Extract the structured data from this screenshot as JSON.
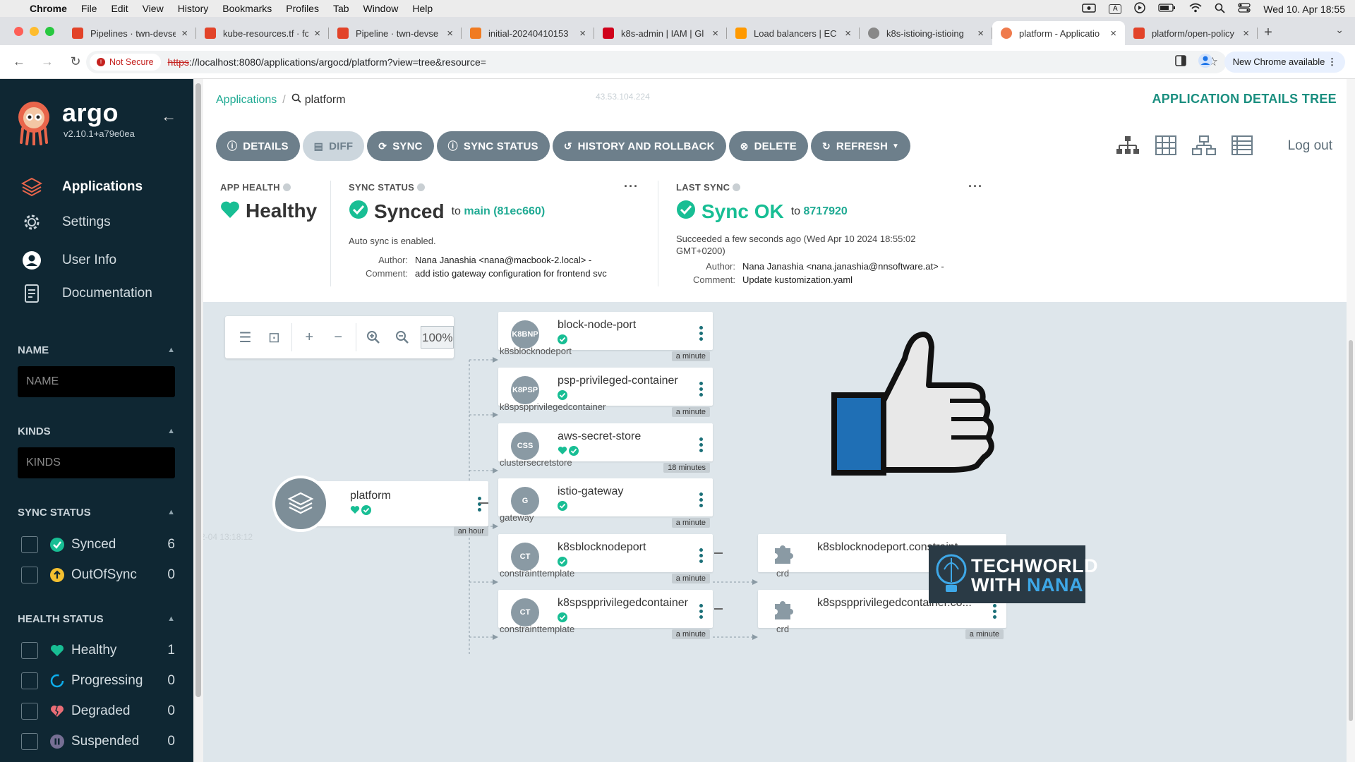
{
  "menubar": {
    "app": "Chrome",
    "items": [
      "File",
      "Edit",
      "View",
      "History",
      "Bookmarks",
      "Profiles",
      "Tab",
      "Window",
      "Help"
    ],
    "clock": "Wed 10. Apr  18:55",
    "input_indicator": "A"
  },
  "tabs": [
    {
      "title": "Pipelines · twn-devse",
      "color": "#e24329"
    },
    {
      "title": "kube-resources.tf · fc",
      "color": "#e24329"
    },
    {
      "title": "Pipeline · twn-devse",
      "color": "#e24329"
    },
    {
      "title": "initial-20240410153",
      "color": "#f07b21"
    },
    {
      "title": "k8s-admin | IAM | Gl",
      "color": "#d0021b"
    },
    {
      "title": "Load balancers | EC",
      "color": "#ff9900"
    },
    {
      "title": "k8s-istioing-istioing",
      "color": "#555555"
    },
    {
      "title": "platform - Applicatio",
      "color": "#ef7b4d",
      "active": true
    },
    {
      "title": "platform/open-policy",
      "color": "#e24329"
    }
  ],
  "address": {
    "security": "Not Secure",
    "proto": "https",
    "url_rest": "://localhost:8080/applications/argocd/platform?view=tree&resource=",
    "new_chrome": "New Chrome available"
  },
  "sidebar": {
    "brand": "argo",
    "version": "v2.10.1+a79e0ea",
    "nav": [
      {
        "label": "Applications",
        "icon": "layers-icon",
        "active": true
      },
      {
        "label": "Settings",
        "icon": "gear-icon"
      },
      {
        "label": "User Info",
        "icon": "user-icon"
      },
      {
        "label": "Documentation",
        "icon": "book-icon"
      }
    ],
    "filters": {
      "name": {
        "title": "NAME",
        "placeholder": "NAME"
      },
      "kinds": {
        "title": "KINDS",
        "placeholder": "KINDS"
      },
      "sync_title": "SYNC STATUS",
      "sync": [
        {
          "label": "Synced",
          "count": "6",
          "color": "#18be94"
        },
        {
          "label": "OutOfSync",
          "count": "0",
          "color": "#f4c030"
        }
      ],
      "health_title": "HEALTH STATUS",
      "health": [
        {
          "label": "Healthy",
          "count": "1",
          "color": "#18be94"
        },
        {
          "label": "Progressing",
          "count": "0",
          "color": "#0dadea"
        },
        {
          "label": "Degraded",
          "count": "0",
          "color": "#e96d76"
        },
        {
          "label": "Suspended",
          "count": "0",
          "color": "#766f94"
        }
      ]
    }
  },
  "header": {
    "crumb_link": "Applications",
    "crumb_current": "platform",
    "title": "APPLICATION DETAILS TREE",
    "logout": "Log out",
    "ghost_ip": "43.53.104.224"
  },
  "toolbar": {
    "details": "DETAILS",
    "diff": "DIFF",
    "sync": "SYNC",
    "sync_status": "SYNC STATUS",
    "history": "HISTORY AND ROLLBACK",
    "delete": "DELETE",
    "refresh": "REFRESH"
  },
  "status": {
    "app_health_label": "APP HEALTH",
    "app_health": "Healthy",
    "sync_label": "SYNC STATUS",
    "sync_value": "Synced",
    "sync_to": "to",
    "sync_rev": "main (81ec660)",
    "auto_sync": "Auto sync is enabled.",
    "sync_author_k": "Author:",
    "sync_author": "Nana Janashia <nana@macbook-2.local> -",
    "sync_comment_k": "Comment:",
    "sync_comment": "add istio gateway configuration for frontend svc",
    "last_label": "LAST SYNC",
    "last_value": "Sync OK",
    "last_to": "to",
    "last_rev": "8717920",
    "last_succeeded": "Succeeded a few seconds ago (Wed Apr 10 2024 18:55:02 GMT+0200)",
    "last_author_k": "Author:",
    "last_author": "Nana Janashia <nana.janashia@nnsoftware.at> -",
    "last_comment_k": "Comment:",
    "last_comment": "Update kustomization.yaml"
  },
  "canvas": {
    "zoom": "100%",
    "ghost_date": "2-04 13:18:12",
    "root": {
      "name": "platform",
      "age": "an hour"
    },
    "nodes": [
      {
        "abbr": "K8BNP",
        "name": "block-node-port",
        "kind": "k8sblocknodeport",
        "age": "a minute",
        "health": false
      },
      {
        "abbr": "K8PSP",
        "name": "psp-privileged-container",
        "kind": "k8spspprivilegedcontainer",
        "age": "a minute",
        "health": false
      },
      {
        "abbr": "CSS",
        "name": "aws-secret-store",
        "kind": "clustersecretstore",
        "age": "18 minutes",
        "health": true
      },
      {
        "abbr": "G",
        "name": "istio-gateway",
        "kind": "gateway",
        "age": "a minute",
        "health": false
      },
      {
        "abbr": "CT",
        "name": "k8sblocknodeport",
        "kind": "constrainttemplate",
        "age": "a minute",
        "health": false
      },
      {
        "abbr": "CT",
        "name": "k8spspprivilegedcontainer",
        "kind": "constrainttemplate",
        "age": "a minute",
        "health": false
      }
    ],
    "crds": [
      {
        "name": "k8sblocknodeport.constraint...",
        "kind": "crd",
        "age": "a minute"
      },
      {
        "name": "k8spspprivilegedcontainer.co...",
        "kind": "crd",
        "age": "a minute"
      }
    ]
  },
  "watermark": {
    "line1": "TECHWORLD",
    "line2a": "WITH ",
    "line2b": "NANA"
  }
}
